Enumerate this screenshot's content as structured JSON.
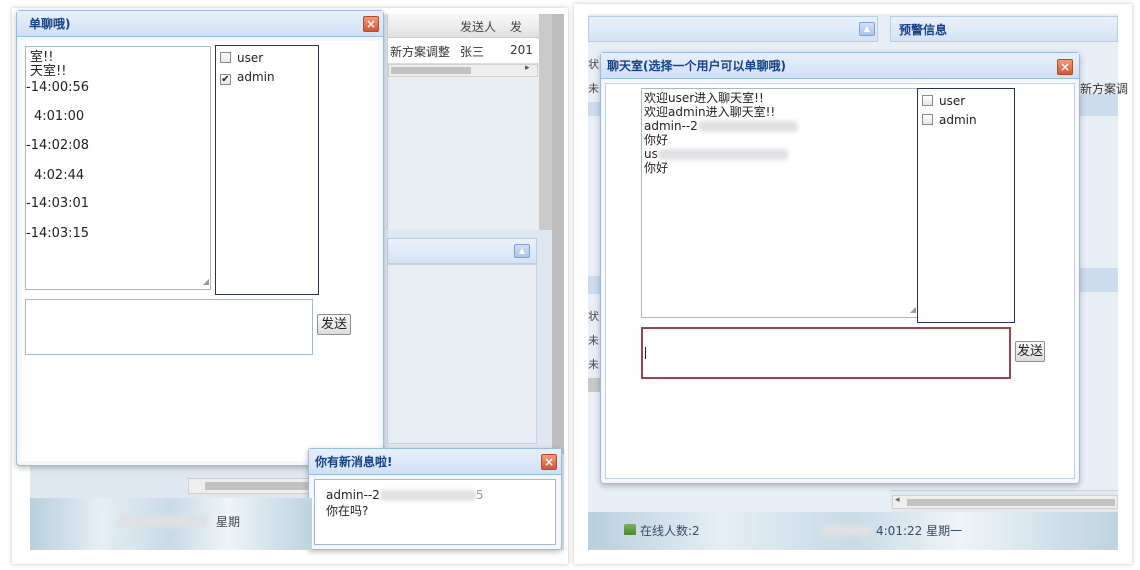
{
  "left": {
    "chat_window": {
      "title": "单聊哦)",
      "close_icon": "×",
      "messages": [
        "室!!",
        "天室!!",
        "-14:00:56",
        "4:01:00",
        "-14:02:08",
        "4:02:44",
        "-14:03:01",
        "-14:03:15"
      ],
      "users": [
        {
          "name": "user",
          "checked": false
        },
        {
          "name": "admin",
          "checked": true
        }
      ],
      "send_label": "发送"
    },
    "bg_table": {
      "headers": [
        "发送人",
        "发"
      ],
      "row": [
        "新方案调整",
        "张三",
        "201"
      ]
    },
    "notification": {
      "title": "你有新消息啦!",
      "close_icon": "×",
      "line1": "admin--2",
      "line1_tail": "5",
      "line2": "你在吗?"
    },
    "taskbar_text": "星期"
  },
  "right": {
    "panel_title": "预警信息",
    "side_texts": [
      "状",
      "未",
      "状",
      "未",
      "未"
    ],
    "right_text": "新方案调",
    "chat_window": {
      "title": "聊天室(选择一个用户可以单聊哦)",
      "close_icon": "×",
      "messages": {
        "m1": "欢迎user进入聊天室!!",
        "m2": "欢迎admin进入聊天室!!",
        "m3": "admin--2",
        "m4": "你好",
        "m5": "us",
        "m6": "你好"
      },
      "users": [
        {
          "name": "user",
          "checked": false
        },
        {
          "name": "admin",
          "checked": false
        }
      ],
      "send_label": "发送"
    },
    "online_label": "在线人数:2",
    "clock_text": "4:01:22 星期一"
  },
  "colors": {
    "window_border": "#99bbe8",
    "title_text": "#15428b",
    "close_button": "#d8552e",
    "active_input_border": "#a0424b",
    "user_list_border": "#2a2f6b"
  }
}
